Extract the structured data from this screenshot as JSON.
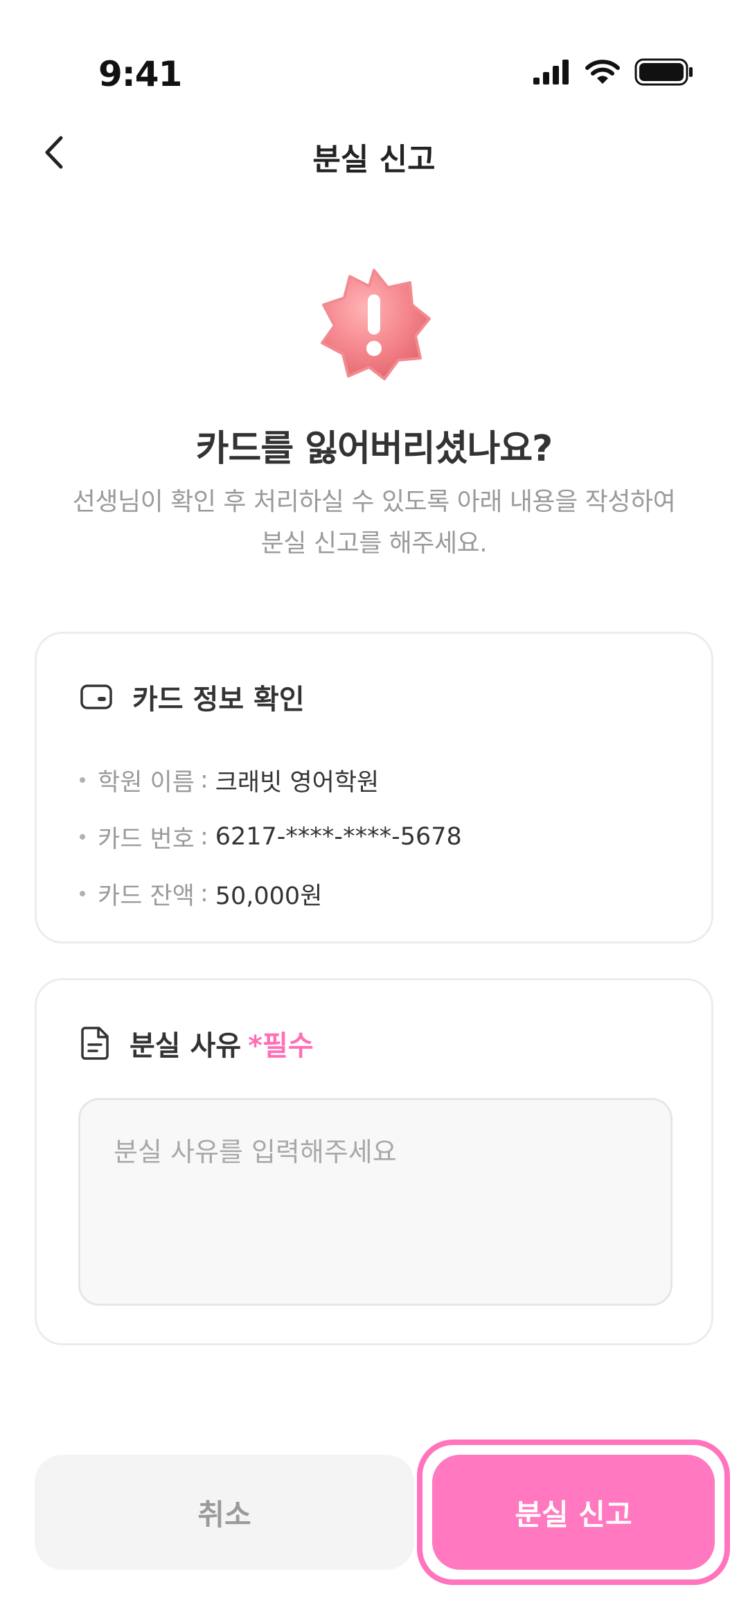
{
  "status_bar": {
    "time": "9:41",
    "icons": [
      "cellular-signal-icon",
      "wifi-icon",
      "battery-icon"
    ]
  },
  "nav": {
    "back_icon": "chevron-left-icon",
    "title": "분실 신고"
  },
  "hero": {
    "badge_icon": "exclamation-badge-icon",
    "badge_color": "#f4838a",
    "headline": "카드를 잃어버리셨나요?",
    "description_line1": "선생님이 확인 후 처리하실 수 있도록 아래 내용을 작성하여",
    "description_line2": "분실 신고를 해주세요."
  },
  "card_info": {
    "icon": "wallet-icon",
    "title": "카드 정보 확인",
    "items": [
      {
        "label": "학원 이름",
        "sep": ":",
        "value": "크래빗 영어학원"
      },
      {
        "label": "카드 번호",
        "sep": ":",
        "value": "6217-****-****-5678"
      },
      {
        "label": "카드 잔액",
        "sep": ":",
        "value": "50,000원"
      }
    ]
  },
  "card_reason": {
    "icon": "document-icon",
    "title": "분실 사유",
    "required": "*필수",
    "input_value": "",
    "input_placeholder": "분실 사유를 입력해주세요"
  },
  "actions": {
    "cancel_label": "취소",
    "submit_label": "분실 신고"
  },
  "colors": {
    "accent": "#ff78c0",
    "text_primary": "#333333",
    "text_secondary": "#9a9a9a"
  }
}
